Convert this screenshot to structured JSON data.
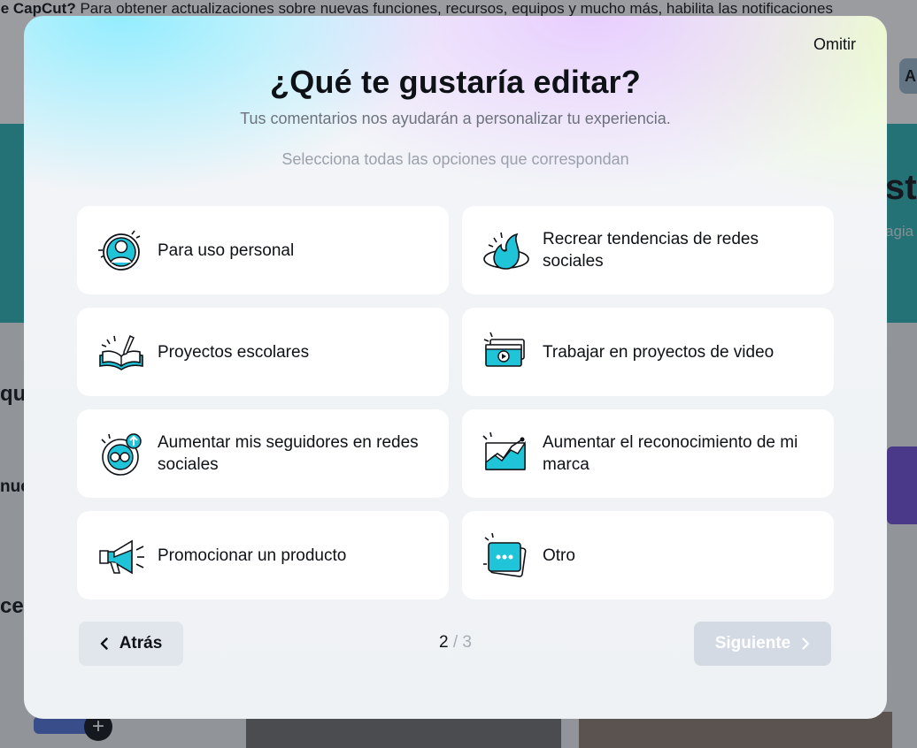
{
  "background": {
    "banner_brand": "le CapCut?",
    "banner_text": "Para obtener actualizaciones sobre nuevas funciones, recursos, equipos y mucho más, habilita las notificaciones",
    "side_a": "A",
    "side_sti": "sti",
    "side_agia": "agia",
    "side_que": "qu",
    "side_nue": "nue",
    "side_ce": "ce",
    "plus": "+"
  },
  "modal": {
    "skip_label": "Omitir",
    "title": "¿Qué te gustaría editar?",
    "subtitle": "Tus comentarios nos ayudarán a personalizar tu experiencia.",
    "hint": "Selecciona todas las opciones que correspondan",
    "options": [
      {
        "label": "Para uso personal",
        "icon": "person-icon"
      },
      {
        "label": "Recrear tendencias de redes sociales",
        "icon": "flame-icon"
      },
      {
        "label": "Proyectos escolares",
        "icon": "book-pen-icon"
      },
      {
        "label": "Trabajar en proyectos de video",
        "icon": "video-clips-icon"
      },
      {
        "label": "Aumentar mis seguidores en redes sociales",
        "icon": "followers-icon"
      },
      {
        "label": "Aumentar el reconocimiento de mi marca",
        "icon": "growth-chart-icon"
      },
      {
        "label": "Promocionar un producto",
        "icon": "megaphone-icon"
      },
      {
        "label": "Otro",
        "icon": "chat-bubble-icon"
      }
    ],
    "back_label": "Atrás",
    "page_current": "2",
    "page_rest": "/ 3",
    "next_label": "Siguiente"
  },
  "colors": {
    "accent": "#20c4d8",
    "ink": "#0e1116",
    "disabled": "#d3dae3"
  }
}
